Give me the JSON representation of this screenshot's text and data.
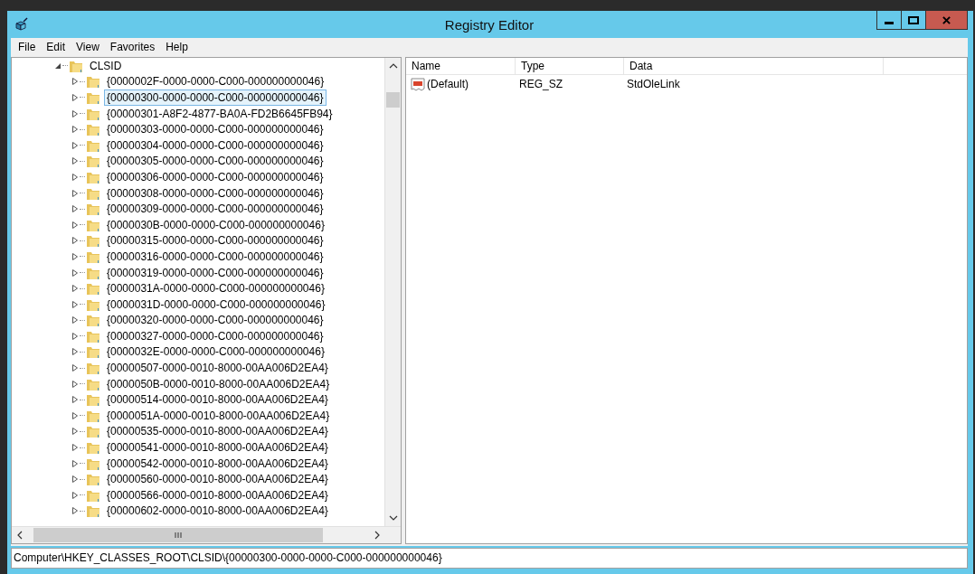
{
  "window": {
    "title": "Registry Editor"
  },
  "menu": [
    "File",
    "Edit",
    "View",
    "Favorites",
    "Help"
  ],
  "tree": [
    {
      "label": "CLSID",
      "expanded": true,
      "selected": false,
      "children": [
        {
          "label": "{0000002F-0000-0000-C000-000000000046}",
          "selected": false,
          "expanded": false
        },
        {
          "label": "{00000300-0000-0000-C000-000000000046}",
          "selected": true,
          "expanded": false
        },
        {
          "label": "{00000301-A8F2-4877-BA0A-FD2B6645FB94}",
          "selected": false,
          "expanded": false
        },
        {
          "label": "{00000303-0000-0000-C000-000000000046}",
          "selected": false,
          "expanded": false
        },
        {
          "label": "{00000304-0000-0000-C000-000000000046}",
          "selected": false,
          "expanded": false
        },
        {
          "label": "{00000305-0000-0000-C000-000000000046}",
          "selected": false,
          "expanded": false
        },
        {
          "label": "{00000306-0000-0000-C000-000000000046}",
          "selected": false,
          "expanded": false
        },
        {
          "label": "{00000308-0000-0000-C000-000000000046}",
          "selected": false,
          "expanded": false
        },
        {
          "label": "{00000309-0000-0000-C000-000000000046}",
          "selected": false,
          "expanded": false
        },
        {
          "label": "{0000030B-0000-0000-C000-000000000046}",
          "selected": false,
          "expanded": false
        },
        {
          "label": "{00000315-0000-0000-C000-000000000046}",
          "selected": false,
          "expanded": false
        },
        {
          "label": "{00000316-0000-0000-C000-000000000046}",
          "selected": false,
          "expanded": false
        },
        {
          "label": "{00000319-0000-0000-C000-000000000046}",
          "selected": false,
          "expanded": false
        },
        {
          "label": "{0000031A-0000-0000-C000-000000000046}",
          "selected": false,
          "expanded": false
        },
        {
          "label": "{0000031D-0000-0000-C000-000000000046}",
          "selected": false,
          "expanded": false
        },
        {
          "label": "{00000320-0000-0000-C000-000000000046}",
          "selected": false,
          "expanded": false
        },
        {
          "label": "{00000327-0000-0000-C000-000000000046}",
          "selected": false,
          "expanded": false
        },
        {
          "label": "{0000032E-0000-0000-C000-000000000046}",
          "selected": false,
          "expanded": false
        },
        {
          "label": "{00000507-0000-0010-8000-00AA006D2EA4}",
          "selected": false,
          "expanded": false
        },
        {
          "label": "{0000050B-0000-0010-8000-00AA006D2EA4}",
          "selected": false,
          "expanded": false
        },
        {
          "label": "{00000514-0000-0010-8000-00AA006D2EA4}",
          "selected": false,
          "expanded": false
        },
        {
          "label": "{0000051A-0000-0010-8000-00AA006D2EA4}",
          "selected": false,
          "expanded": false
        },
        {
          "label": "{00000535-0000-0010-8000-00AA006D2EA4}",
          "selected": false,
          "expanded": false
        },
        {
          "label": "{00000541-0000-0010-8000-00AA006D2EA4}",
          "selected": false,
          "expanded": false
        },
        {
          "label": "{00000542-0000-0010-8000-00AA006D2EA4}",
          "selected": false,
          "expanded": false
        },
        {
          "label": "{00000560-0000-0010-8000-00AA006D2EA4}",
          "selected": false,
          "expanded": false
        },
        {
          "label": "{00000566-0000-0010-8000-00AA006D2EA4}",
          "selected": false,
          "expanded": false
        },
        {
          "label": "{00000602-0000-0010-8000-00AA006D2EA4}",
          "selected": false,
          "expanded": false
        }
      ]
    }
  ],
  "values": {
    "columns": [
      "Name",
      "Type",
      "Data"
    ],
    "rows": [
      {
        "kind": "string",
        "name": "(Default)",
        "type": "REG_SZ",
        "data": "StdOleLink",
        "selected": false
      }
    ]
  },
  "status_bar": "Computer\\HKEY_CLASSES_ROOT\\CLSID\\{00000300-0000-0000-C000-000000000046}"
}
